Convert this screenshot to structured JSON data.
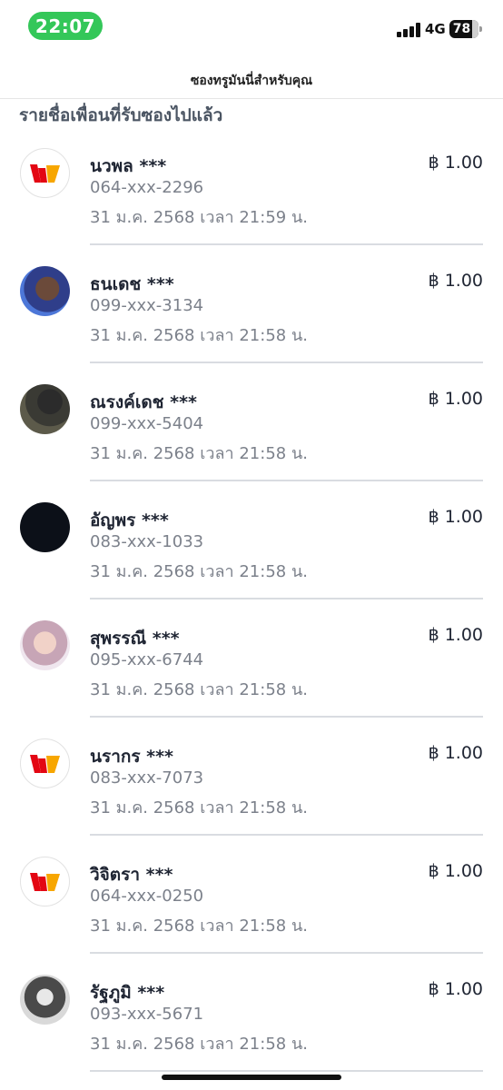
{
  "status_bar": {
    "time": "22:07",
    "network": "4G",
    "battery": "78",
    "accent": "#34c759"
  },
  "header": {
    "title": "ซองทรูมันนี่สำหรับคุณ"
  },
  "section": {
    "heading": "รายชื่อเพื่อนที่รับซองไปแล้ว"
  },
  "recipients": [
    {
      "avatar": "truemoney-logo-icon",
      "name": "นวพล ***",
      "phone": "064-xxx-2296",
      "datetime": "31 ม.ค. 2568 เวลา 21:59 น.",
      "amount": "฿ 1.00"
    },
    {
      "avatar": "user-photo",
      "name": "ธนเดช ***",
      "phone": "099-xxx-3134",
      "datetime": "31 ม.ค. 2568 เวลา 21:58 น.",
      "amount": "฿ 1.00"
    },
    {
      "avatar": "user-photo",
      "name": "ณรงค์เดช ***",
      "phone": "099-xxx-5404",
      "datetime": "31 ม.ค. 2568 เวลา 21:58 น.",
      "amount": "฿ 1.00"
    },
    {
      "avatar": "user-photo",
      "name": "อัญพร ***",
      "phone": "083-xxx-1033",
      "datetime": "31 ม.ค. 2568 เวลา 21:58 น.",
      "amount": "฿ 1.00"
    },
    {
      "avatar": "user-photo",
      "name": "สุพรรณี ***",
      "phone": "095-xxx-6744",
      "datetime": "31 ม.ค. 2568 เวลา 21:58 น.",
      "amount": "฿ 1.00"
    },
    {
      "avatar": "truemoney-logo-icon",
      "name": "นรากร ***",
      "phone": "083-xxx-7073",
      "datetime": "31 ม.ค. 2568 เวลา 21:58 น.",
      "amount": "฿ 1.00"
    },
    {
      "avatar": "truemoney-logo-icon",
      "name": "วิจิตรา ***",
      "phone": "064-xxx-0250",
      "datetime": "31 ม.ค. 2568 เวลา 21:58 น.",
      "amount": "฿ 1.00"
    },
    {
      "avatar": "user-photo",
      "name": "รัฐภูมิ ***",
      "phone": "093-xxx-5671",
      "datetime": "31 ม.ค. 2568 เวลา 21:58 น.",
      "amount": "฿ 1.00"
    }
  ]
}
